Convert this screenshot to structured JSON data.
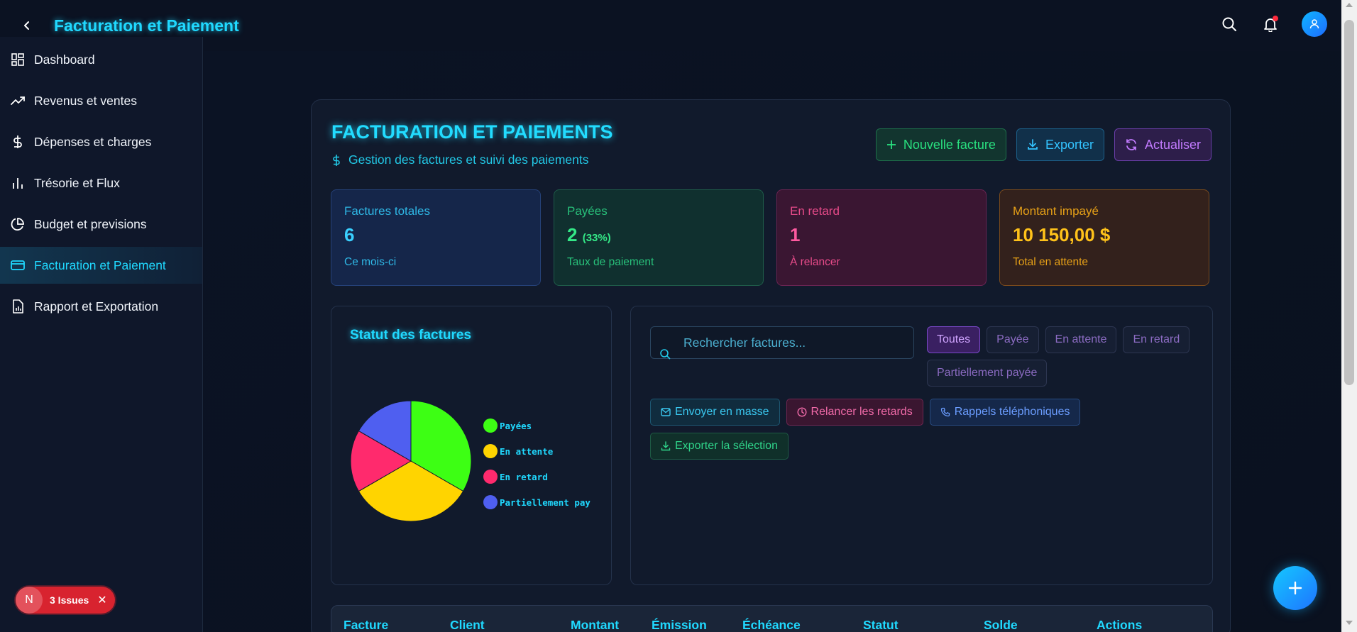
{
  "app": {
    "title": "Facturation et Paiement"
  },
  "sidebar": {
    "items": [
      {
        "label": "Dashboard",
        "icon": "dashboard-grid-icon"
      },
      {
        "label": "Revenus et ventes",
        "icon": "trending-up-icon"
      },
      {
        "label": "Dépenses et charges",
        "icon": "dollar-icon"
      },
      {
        "label": "Trésorie et Flux",
        "icon": "bar-chart-icon"
      },
      {
        "label": "Budget et previsions",
        "icon": "pie-chart-icon"
      },
      {
        "label": "Facturation et Paiement",
        "icon": "credit-card-icon",
        "active": true
      },
      {
        "label": "Rapport et Exportation",
        "icon": "file-report-icon"
      }
    ]
  },
  "issues": {
    "badge_letter": "N",
    "label": "3 Issues"
  },
  "header": {
    "title": "FACTURATION ET PAIEMENTS",
    "subtitle": "Gestion des factures et suivi des paiements",
    "buttons": {
      "new_invoice": "Nouvelle facture",
      "export": "Exporter",
      "refresh": "Actualiser"
    }
  },
  "stats": [
    {
      "label": "Factures totales",
      "value": "6",
      "extra": "",
      "foot": "Ce mois-ci"
    },
    {
      "label": "Payées",
      "value": "2",
      "extra": "(33%)",
      "foot": "Taux de paiement"
    },
    {
      "label": "En retard",
      "value": "1",
      "extra": "",
      "foot": "À relancer"
    },
    {
      "label": "Montant impayé",
      "value": "10 150,00 $",
      "extra": "",
      "foot": "Total en attente"
    }
  ],
  "chart_data": {
    "type": "pie",
    "title": "Statut des factures",
    "categories": [
      "Payées",
      "En attente",
      "En retard",
      "Partiellement pay"
    ],
    "values": [
      2,
      2,
      1,
      1
    ],
    "colors": [
      "#3dff14",
      "#ffd400",
      "#ff2a6d",
      "#4f5ff0"
    ],
    "legend": "right"
  },
  "filters": {
    "search_placeholder": "Rechercher factures...",
    "chips": [
      "Toutes",
      "Payée",
      "En attente",
      "En retard",
      "Partiellement payée"
    ],
    "active_chip": "Toutes"
  },
  "bulk_actions": {
    "send_bulk": "Envoyer en masse",
    "remind_late": "Relancer les retards",
    "phone_reminders": "Rappels téléphoniques",
    "export_selection": "Exporter la sélection"
  },
  "table": {
    "columns": [
      "Facture",
      "Client",
      "Montant",
      "Émission",
      "Échéance",
      "Statut",
      "Solde",
      "Actions"
    ]
  }
}
